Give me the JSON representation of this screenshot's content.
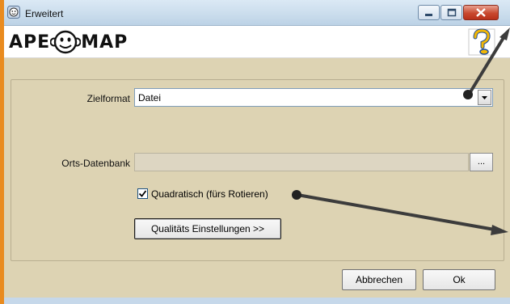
{
  "window": {
    "title": "Erweitert",
    "controls": {
      "minimize": "minimize",
      "maximize": "maximize",
      "close": "close"
    }
  },
  "header": {
    "logo_left": "APE",
    "logo_right": "MAP",
    "help_icon": "question-mark-icon"
  },
  "form": {
    "target_format": {
      "label": "Zielformat",
      "value": "Datei"
    },
    "location_db": {
      "label": "Orts-Datenbank",
      "value": "",
      "browse_label": "..."
    },
    "square": {
      "label": "Quadratisch (fürs Rotieren)",
      "checked": true
    },
    "quality_button": "Qualitäts Einstellungen >>"
  },
  "footer": {
    "cancel_label": "Abbrechen",
    "ok_label": "Ok"
  },
  "colors": {
    "frame_accent": "#e98b1f",
    "dialog_bg": "#ddd3b3",
    "annotation": "#3c3c3c"
  }
}
